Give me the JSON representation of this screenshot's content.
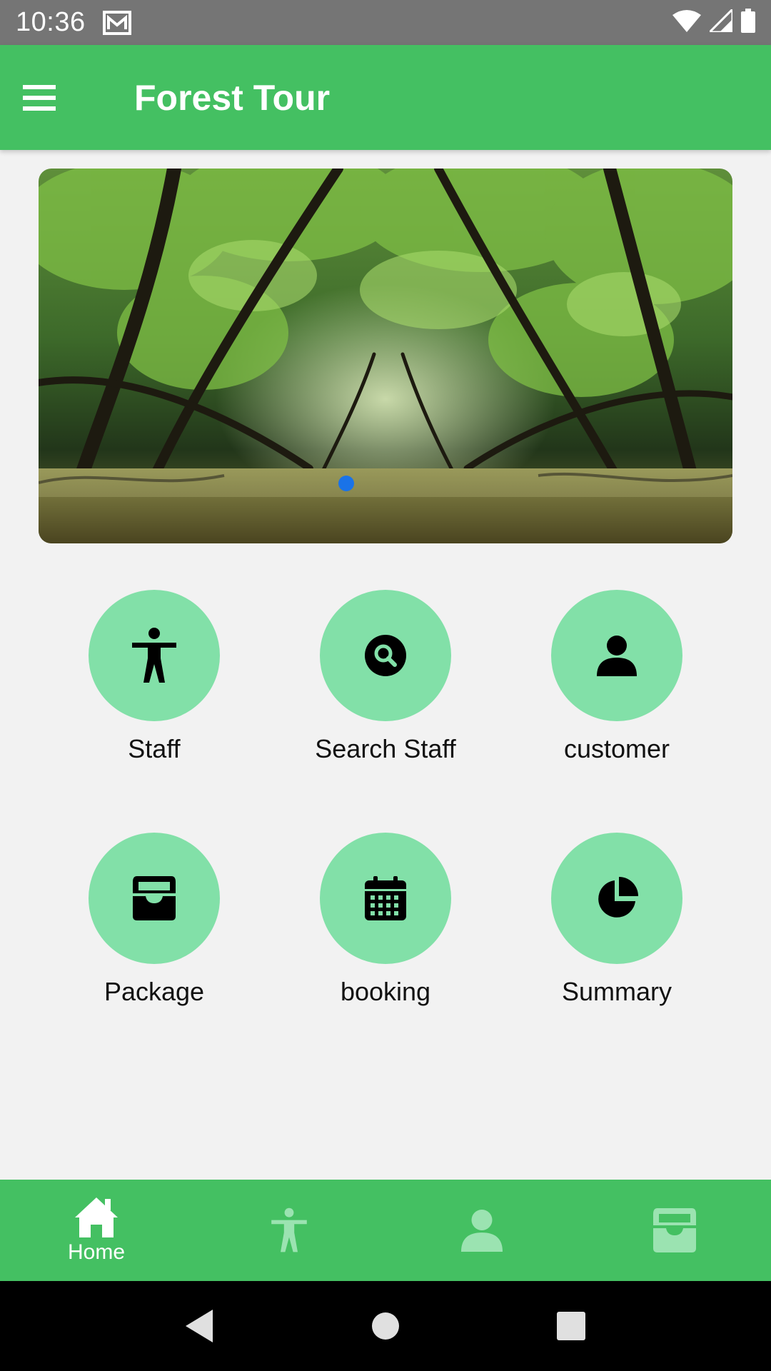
{
  "status_bar": {
    "time": "10:36"
  },
  "app_bar": {
    "title": "Forest Tour"
  },
  "menu": [
    {
      "label": "Staff",
      "icon": "person-standing-icon"
    },
    {
      "label": "Search Staff",
      "icon": "search-icon"
    },
    {
      "label": "customer",
      "icon": "user-icon"
    },
    {
      "label": "Package",
      "icon": "inbox-box-icon"
    },
    {
      "label": "booking",
      "icon": "calendar-icon"
    },
    {
      "label": "Summary",
      "icon": "pie-chart-icon"
    }
  ],
  "bottom_nav": {
    "home_label": "Home",
    "items": [
      "home-icon",
      "person-standing-icon",
      "user-icon",
      "inbox-box-icon"
    ]
  },
  "colors": {
    "primary": "#44c062",
    "circle": "#82e0a8",
    "status_bar": "#757575",
    "carousel_dot": "#1a73e8"
  }
}
